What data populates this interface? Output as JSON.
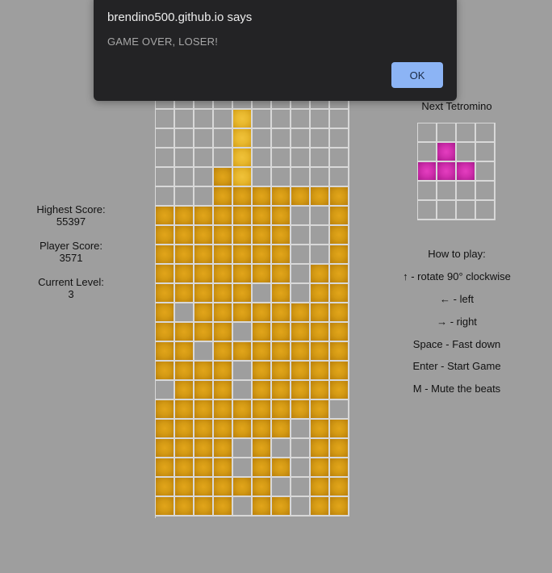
{
  "dialog": {
    "title": "brendino500.github.io says",
    "message": "GAME OVER, LOSER!",
    "ok_label": "OK"
  },
  "stats": {
    "highest_label": "Highest Score:",
    "highest_value": "55397",
    "player_label": "Player Score:",
    "player_value": "3571",
    "level_label": "Current Level:",
    "level_value": "3"
  },
  "next": {
    "title": "Next Tetromino",
    "grid": [
      "....",
      ".m..",
      "mmm.",
      "....",
      "...."
    ]
  },
  "help": {
    "title": "How to play:",
    "items": [
      "↑ - rotate 90° clockwise",
      "← - left",
      "→ - right",
      "Space - Fast down",
      "Enter - Start Game",
      "M - Mute the beats"
    ]
  },
  "board": {
    "rows": [
      "..........",
      "....a.....",
      "....a.....",
      "....a.....",
      "...fa.....",
      "...fffffff",
      "fffffff..f",
      "fffffff..f",
      "fffffff..f",
      "fffffff.ff",
      "fffff.f.ff",
      "f.ffffffff",
      "ffff.fffff",
      "ff.fffffff",
      "ffff.fffff",
      ".fff.fffff",
      "fffffffff.",
      "fffffff.ff",
      "ffff.f..ff",
      "ffff.ff.ff",
      "ffffff..ff",
      "ffff.ff.ff"
    ]
  },
  "colors": {
    "background": "#9e9e9e",
    "block": "#d49a14",
    "active_block": "#e8b82e",
    "next_block": "#d12fae",
    "grid_line": "#d8d8d8",
    "dialog_bg": "#232325",
    "ok_button": "#8cb4f5"
  }
}
